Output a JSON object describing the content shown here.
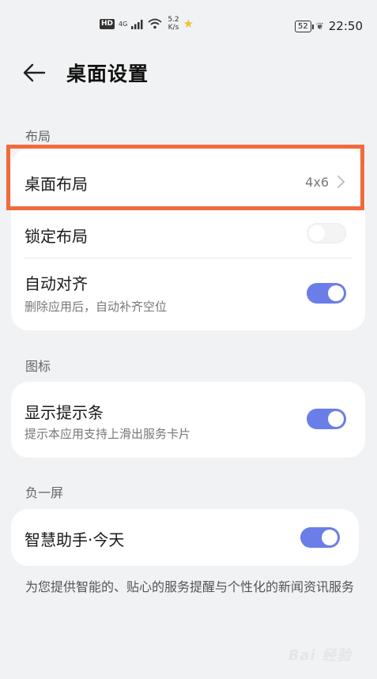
{
  "status_bar": {
    "hd": "HD",
    "network": "4G",
    "speed_value": "5.2",
    "speed_unit": "K/s",
    "battery": "52",
    "time": "22:50"
  },
  "header": {
    "title": "桌面设置"
  },
  "sections": {
    "layout": {
      "label": "布局",
      "desktop_layout": {
        "title": "桌面布局",
        "value": "4x6"
      },
      "lock_layout": {
        "title": "锁定布局",
        "enabled": false
      },
      "auto_align": {
        "title": "自动对齐",
        "subtitle": "删除应用后，自动补齐空位",
        "enabled": true
      }
    },
    "icons": {
      "label": "图标",
      "show_hint_bar": {
        "title": "显示提示条",
        "subtitle": "提示本应用支持上滑出服务卡片",
        "enabled": true
      }
    },
    "minus_one_screen": {
      "label": "负一屏",
      "smart_assistant": {
        "title": "智慧助手·今天",
        "enabled": true
      },
      "note": "为您提供智能的、贴心的服务提醒与个性化的新闻资讯服务"
    }
  },
  "watermark": "Bai 经验",
  "colors": {
    "accent": "#6b7de8",
    "highlight": "#f16a3d",
    "background": "#f1f2f4"
  }
}
